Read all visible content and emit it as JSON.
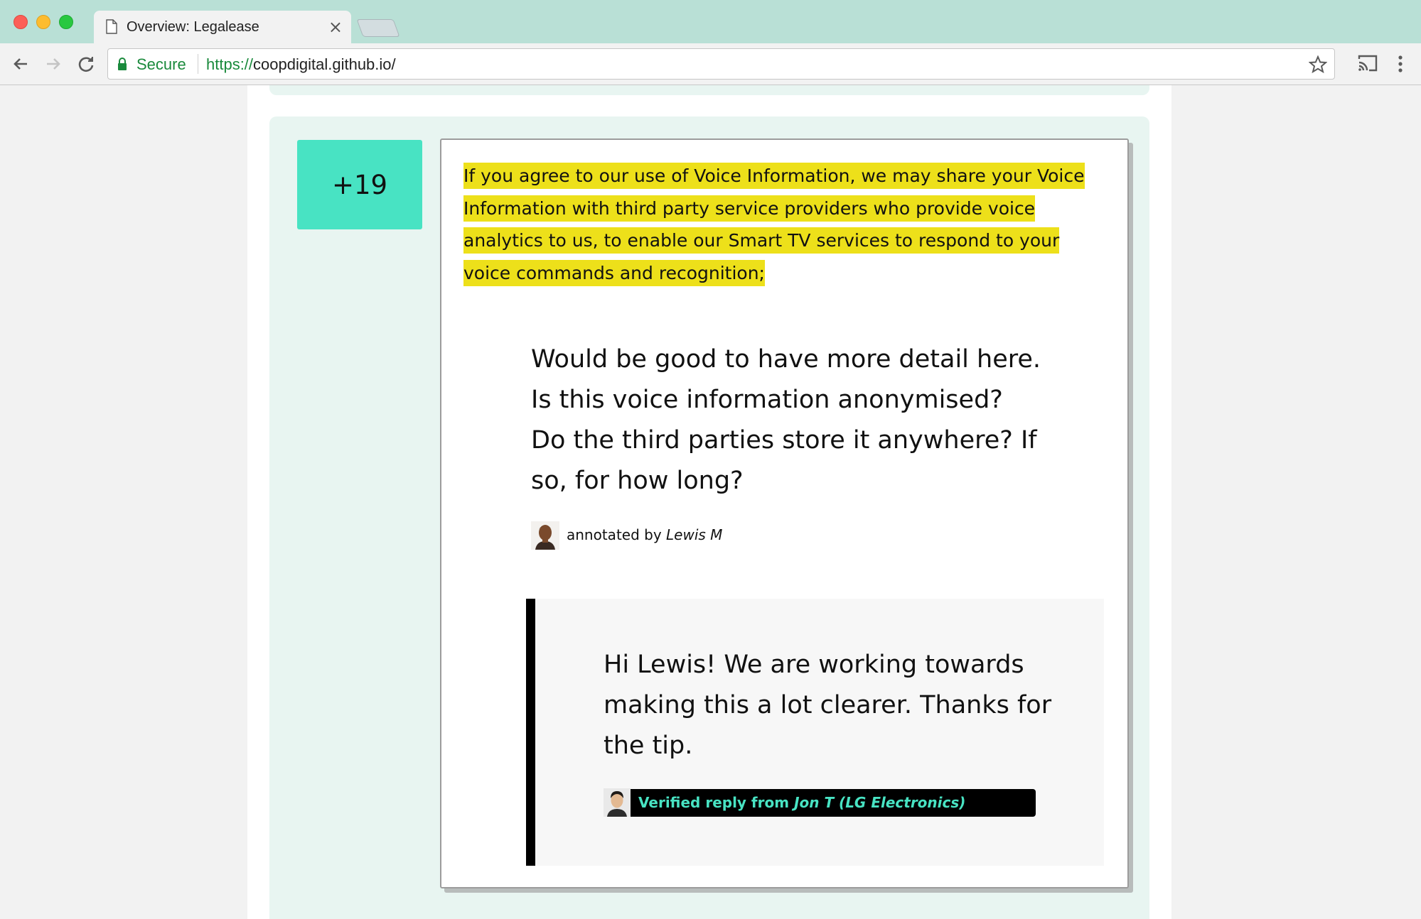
{
  "browser": {
    "tab_title": "Overview: Legalease",
    "tab_close": "×",
    "secure_label": "Secure",
    "url_scheme": "https://",
    "url_rest": "coopdigital.github.io/"
  },
  "annotation": {
    "score": "+19",
    "clause": "If you agree to our use of Voice Information, we may share your Voice Information with third party service providers who provide voice analytics to us, to enable our Smart TV services to respond to your voice commands and recognition;",
    "comment": "Would be good to have more detail here. Is this voice information anonymised? Do the third parties store it anywhere? If so, for how long?",
    "annotated_by_prefix": "annotated by",
    "annotated_by_name": "Lewis M"
  },
  "reply": {
    "text": "Hi Lewis! We are working towards making this a lot clearer. Thanks for the tip.",
    "verified_prefix": "Verified reply from",
    "verified_name": "Jon T (LG Electronics)"
  },
  "colors": {
    "titlebar": "#b9e0d6",
    "card_bg": "#e8f5f1",
    "score_bg": "#48e3c3",
    "highlight": "#ede01a",
    "verified_text": "#48e3c3",
    "secure_green": "#1a8a3c"
  },
  "icons": [
    "close-window-icon",
    "minimize-window-icon",
    "maximize-window-icon",
    "document-icon",
    "back-arrow-icon",
    "forward-arrow-icon",
    "reload-icon",
    "lock-icon",
    "star-icon",
    "cast-icon",
    "more-vert-icon"
  ]
}
